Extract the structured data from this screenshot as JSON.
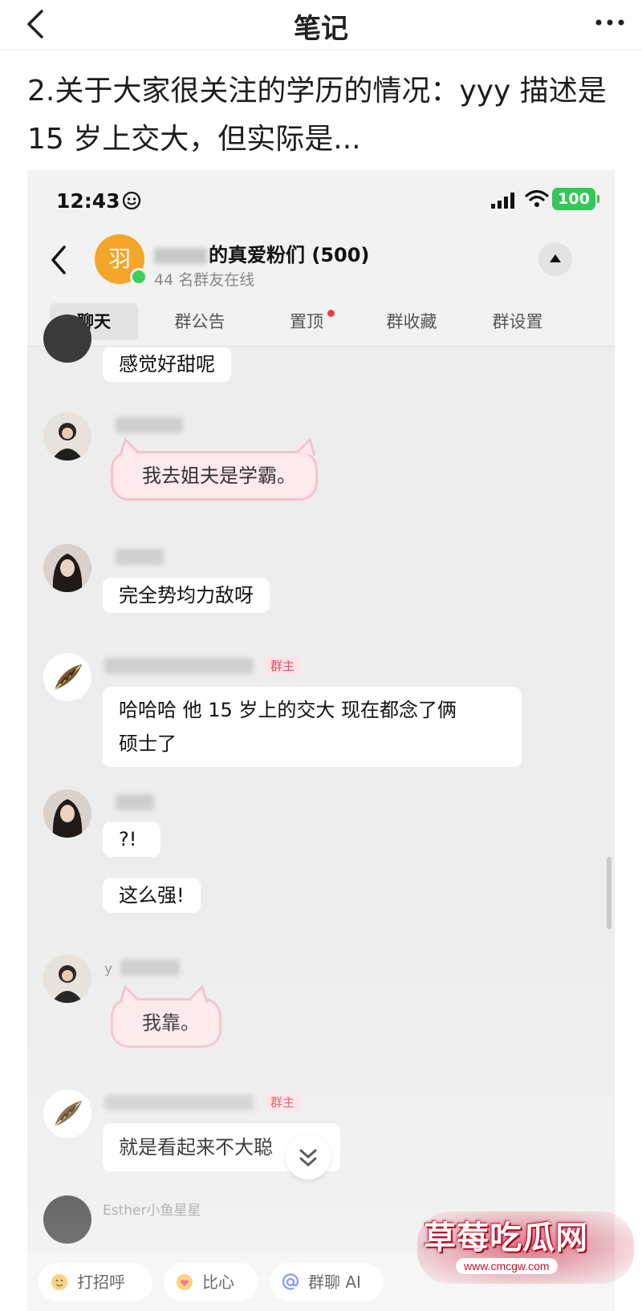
{
  "note": {
    "title": "笔记",
    "body": "2.关于大家很关注的学历的情况：yyy 描述是 15 岁上交大，但实际是..."
  },
  "status": {
    "time": "12:43",
    "battery": "100"
  },
  "group": {
    "avatar_char": "羽",
    "name_visible": "的真爱粉们 (500)",
    "online": "44 名群友在线"
  },
  "tabs": [
    "聊天",
    "群公告",
    "置顶",
    "群收藏",
    "群设置"
  ],
  "messages": {
    "m1": "感觉好甜呢",
    "m2": "我去姐夫是学霸。",
    "m3": "完全势均力敌呀",
    "m4_line1": "哈哈哈 他 15 岁上的交大 现在都念了俩",
    "m4_line2": "硕士了",
    "m5": "?!",
    "m6": "这么强!",
    "m7": "我靠。",
    "m8": "就是看起来不大聪"
  },
  "nicks": {
    "owner_tag": "群主",
    "last_nick": "Esther小鱼星星",
    "y_prefix": "y"
  },
  "quick_actions": [
    "打招呼",
    "比心",
    "群聊 AI"
  ],
  "watermark": {
    "text": "草莓吃瓜网",
    "url": "www.cmcgw.com"
  },
  "colors": {
    "accent_green": "#34c759",
    "owner_red": "#e84a5f",
    "group_avatar": "#f4a62a",
    "watermark_red": "#c8102e"
  }
}
